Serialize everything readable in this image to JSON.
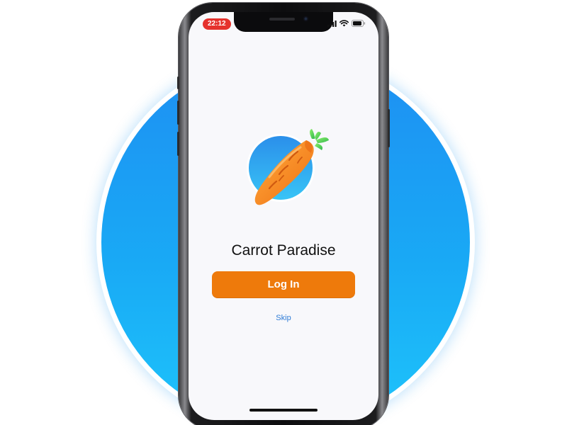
{
  "status_bar": {
    "time": "22:12",
    "icons": [
      "signal-icon",
      "wifi-icon",
      "battery-icon"
    ]
  },
  "app": {
    "logo_icon": "carrot-logo-icon",
    "title": "Carrot Paradise"
  },
  "actions": {
    "login_label": "Log In",
    "skip_label": "Skip"
  },
  "colors": {
    "background_circle": "#1a9cf3",
    "accent_button": "#ee7a0b",
    "link": "#2e7bd6",
    "status_time_pill": "#e5322d"
  }
}
